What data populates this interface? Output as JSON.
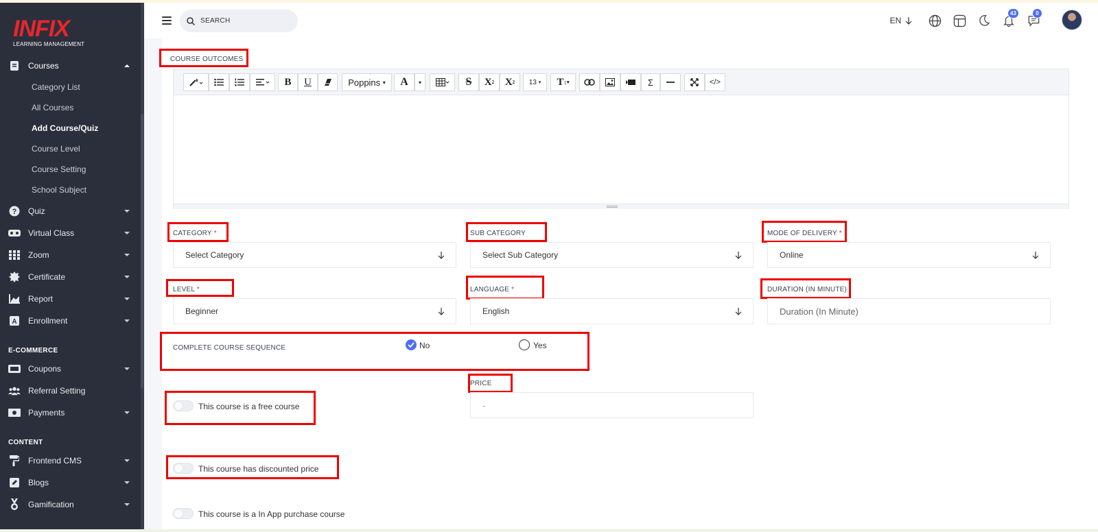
{
  "brand": {
    "name": "INFIX",
    "subtitle": "LEARNING MANAGEMENT"
  },
  "header": {
    "search_placeholder": "SEARCH",
    "language": "EN",
    "notifications_count": "43",
    "messages_count": "0"
  },
  "sidebar": {
    "courses": {
      "label": "Courses",
      "children": [
        "Category List",
        "All Courses",
        "Add Course/Quiz",
        "Course Level",
        "Course Setting",
        "School Subject"
      ],
      "active_child": "Add Course/Quiz"
    },
    "items": [
      {
        "label": "Quiz",
        "icon": "question-circle-icon"
      },
      {
        "label": "Virtual Class",
        "icon": "vr-headset-icon"
      },
      {
        "label": "Zoom",
        "icon": "grid-icon"
      },
      {
        "label": "Certificate",
        "icon": "badge-icon"
      },
      {
        "label": "Report",
        "icon": "chart-icon"
      },
      {
        "label": "Enrollment",
        "icon": "enrollment-icon"
      }
    ],
    "ecommerce": {
      "title": "E-COMMERCE",
      "items": [
        {
          "label": "Coupons",
          "icon": "ticket-icon"
        },
        {
          "label": "Referral Setting",
          "icon": "users-icon"
        },
        {
          "label": "Payments",
          "icon": "money-icon"
        }
      ]
    },
    "content": {
      "title": "CONTENT",
      "items": [
        {
          "label": "Frontend CMS",
          "icon": "paint-roller-icon"
        },
        {
          "label": "Blogs",
          "icon": "edit-icon"
        },
        {
          "label": "Gamification",
          "icon": "medal-icon"
        }
      ]
    }
  },
  "editor": {
    "label": "COURSE OUTCOMES",
    "font": "Poppins",
    "font_size": "13"
  },
  "form": {
    "category": {
      "label": "CATEGORY",
      "required": "*",
      "value": "Select Category"
    },
    "sub_category": {
      "label": "SUB CATEGORY",
      "value": "Select Sub Category"
    },
    "mode_of_delivery": {
      "label": "MODE OF DELIVERY",
      "required": "*",
      "value": "Online"
    },
    "level": {
      "label": "LEVEL",
      "required": "*",
      "value": "Beginner"
    },
    "language": {
      "label": "LANGUAGE",
      "required": "*",
      "value": "English"
    },
    "duration": {
      "label": "DURATION (IN MINUTE)",
      "placeholder": "Duration (In Minute)"
    },
    "sequence": {
      "label": "COMPLETE COURSE SEQUENCE",
      "options": [
        "No",
        "Yes"
      ],
      "selected": "No"
    },
    "price": {
      "label": "PRICE",
      "placeholder": "-"
    },
    "toggles": {
      "free": "This course is a free course",
      "discount": "This course has discounted price",
      "in_app": "This course is a In App purchase course"
    }
  },
  "colors": {
    "sidebar_bg": "#2b2f3b",
    "brand_red": "#e8262d",
    "accent": "#4c6ef5",
    "highlight": "#ee0000"
  }
}
